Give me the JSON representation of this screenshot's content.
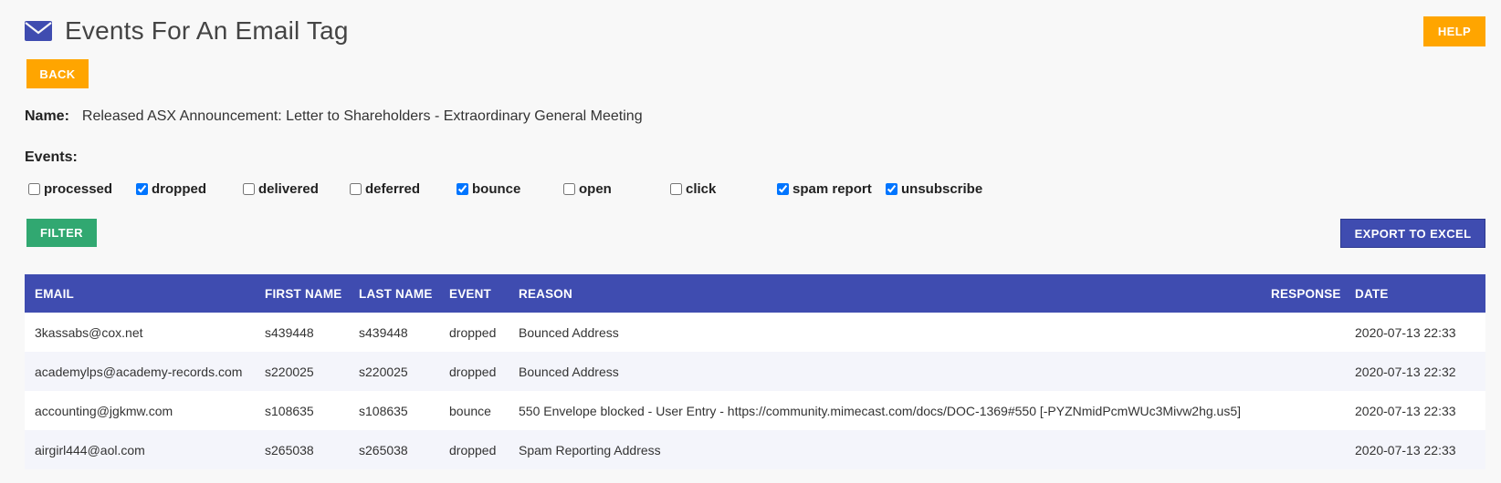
{
  "header": {
    "title": "Events For An Email Tag",
    "icon": "envelope-icon",
    "help_label": "HELP",
    "back_label": "BACK"
  },
  "name": {
    "label": "Name:",
    "value": "Released ASX Announcement: Letter to Shareholders - Extraordinary General Meeting"
  },
  "events": {
    "label": "Events:",
    "options": [
      {
        "label": "processed",
        "checked": false
      },
      {
        "label": "dropped",
        "checked": true
      },
      {
        "label": "delivered",
        "checked": false
      },
      {
        "label": "deferred",
        "checked": false
      },
      {
        "label": "bounce",
        "checked": true
      },
      {
        "label": "open",
        "checked": false
      },
      {
        "label": "click",
        "checked": false
      },
      {
        "label": "spam report",
        "checked": true
      },
      {
        "label": "unsubscribe",
        "checked": true
      }
    ]
  },
  "actions": {
    "filter_label": "FILTER",
    "export_label": "EXPORT TO EXCEL"
  },
  "table": {
    "columns": [
      "EMAIL",
      "FIRST NAME",
      "LAST NAME",
      "EVENT",
      "REASON",
      "RESPONSE",
      "DATE"
    ],
    "rows": [
      [
        "3kassabs@cox.net",
        "s439448",
        "s439448",
        "dropped",
        "Bounced Address",
        "",
        "2020-07-13 22:33"
      ],
      [
        "academylps@academy-records.com",
        "s220025",
        "s220025",
        "dropped",
        "Bounced Address",
        "",
        "2020-07-13 22:32"
      ],
      [
        "accounting@jgkmw.com",
        "s108635",
        "s108635",
        "bounce",
        "550 Envelope blocked - User Entry - https://community.mimecast.com/docs/DOC-1369#550 [-PYZNmidPcmWUc3Mivw2hg.us5]",
        "",
        "2020-07-13 22:33"
      ],
      [
        "airgirl444@aol.com",
        "s265038",
        "s265038",
        "dropped",
        "Spam Reporting Address",
        "",
        "2020-07-13 22:33"
      ]
    ]
  },
  "colors": {
    "primary": "#3f4cb0",
    "accent": "#ffa500",
    "success": "#31a871"
  }
}
